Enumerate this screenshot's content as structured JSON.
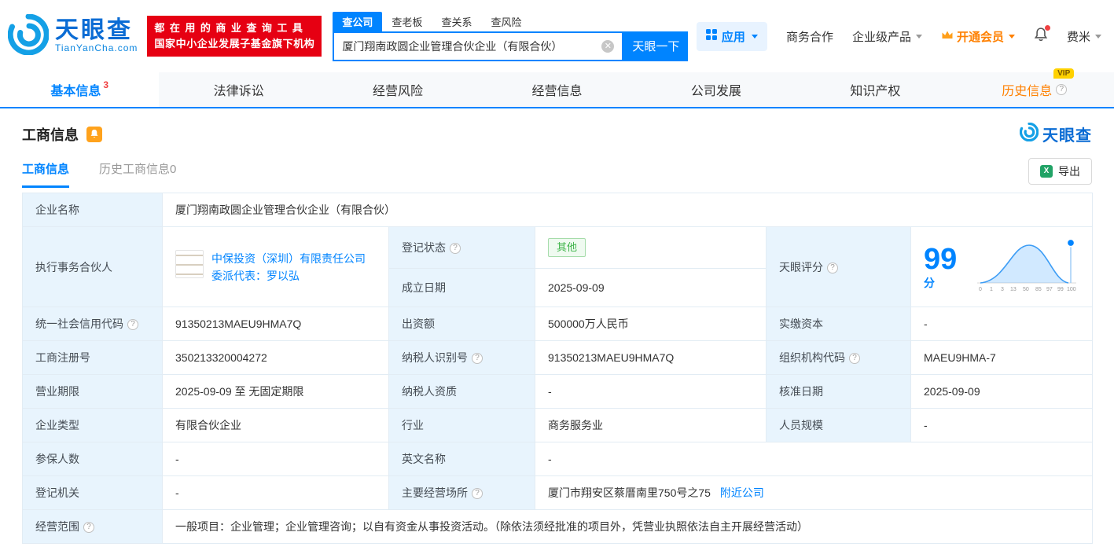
{
  "header": {
    "logo": {
      "cn": "天眼查",
      "en": "TianYanCha.com"
    },
    "slogan": {
      "line1": "都在用的商业查询工具",
      "line2": "国家中小企业发展子基金旗下机构"
    },
    "search": {
      "tabs": [
        {
          "label": "查公司"
        },
        {
          "label": "查老板"
        },
        {
          "label": "查关系"
        },
        {
          "label": "查风险"
        }
      ],
      "value": "厦门翔南政圆企业管理合伙企业（有限合伙）",
      "button": "天眼一下"
    },
    "right": {
      "apps": "应用",
      "cooperation": "商务合作",
      "enterprise": "企业级产品",
      "vip": "开通会员",
      "user": "费米"
    }
  },
  "tabs": {
    "items": [
      {
        "label": "基本信息",
        "badge": "3"
      },
      {
        "label": "法律诉讼"
      },
      {
        "label": "经营风险"
      },
      {
        "label": "经营信息"
      },
      {
        "label": "公司发展"
      },
      {
        "label": "知识产权"
      },
      {
        "label": "历史信息",
        "vip": "VIP"
      }
    ]
  },
  "section": {
    "title": "工商信息",
    "brand": "天眼查",
    "subtabs": [
      {
        "label": "工商信息"
      },
      {
        "label": "历史工商信息0"
      }
    ],
    "export": "导出"
  },
  "info": {
    "company_name": {
      "label": "企业名称",
      "value": "厦门翔南政圆企业管理合伙企业（有限合伙）"
    },
    "partner": {
      "label": "执行事务合伙人",
      "company": "中保投资（深圳）有限责任公司",
      "rep": "委派代表：罗以弘"
    },
    "reg_status": {
      "label": "登记状态",
      "value": "其他"
    },
    "establish_date": {
      "label": "成立日期",
      "value": "2025-09-09"
    },
    "score": {
      "label": "天眼评分",
      "value": "99",
      "unit": "分",
      "ticks": [
        "0",
        "1",
        "3",
        "13",
        "50",
        "85",
        "97",
        "99",
        "100"
      ]
    },
    "credit_code": {
      "label": "统一社会信用代码",
      "value": "91350213MAEU9HMA7Q"
    },
    "capital": {
      "label": "出资额",
      "value": "500000万人民币"
    },
    "paid_capital": {
      "label": "实缴资本",
      "value": "-"
    },
    "reg_number": {
      "label": "工商注册号",
      "value": "350213320004272"
    },
    "taxpayer_id": {
      "label": "纳税人识别号",
      "value": "91350213MAEU9HMA7Q"
    },
    "org_code": {
      "label": "组织机构代码",
      "value": "MAEU9HMA-7"
    },
    "business_term": {
      "label": "营业期限",
      "value": "2025-09-09 至 无固定期限"
    },
    "taxpayer_qualification": {
      "label": "纳税人资质",
      "value": "-"
    },
    "approval_date": {
      "label": "核准日期",
      "value": "2025-09-09"
    },
    "company_type": {
      "label": "企业类型",
      "value": "有限合伙企业"
    },
    "industry": {
      "label": "行业",
      "value": "商务服务业"
    },
    "staff_size": {
      "label": "人员规模",
      "value": "-"
    },
    "insured_count": {
      "label": "参保人数",
      "value": "-"
    },
    "english_name": {
      "label": "英文名称",
      "value": "-"
    },
    "reg_authority": {
      "label": "登记机关",
      "value": "-"
    },
    "premises": {
      "label": "主要经营场所",
      "value": "厦门市翔安区蔡厝南里750号之75",
      "link": "附近公司"
    },
    "business_scope": {
      "label": "经营范围",
      "value": "一般项目：企业管理；企业管理咨询；以自有资金从事投资活动。（除依法须经批准的项目外，凭营业执照依法自主开展经营活动）"
    }
  },
  "colors": {
    "primary": "#0084ff",
    "red": "#e60012",
    "orange": "#ff8000",
    "green": "#3eb449",
    "label_bg": "#e8f4fd"
  }
}
